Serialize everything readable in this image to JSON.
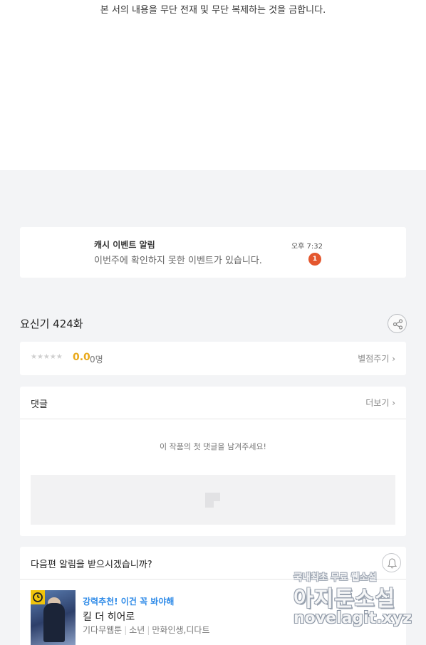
{
  "notice": {
    "copyright": "본 서의 내용을 무단 전재 및 무단 복제하는 것을 금합니다."
  },
  "notification": {
    "title": "캐시 이벤트 알림",
    "message": "이번주에 확인하지 못한 이벤트가 있습니다.",
    "time": "오후 7:32",
    "badge_count": "1"
  },
  "episode": {
    "title": "요신기 424화",
    "share_icon": "share-icon"
  },
  "rating": {
    "stars": "★★★★★",
    "score": "0.0",
    "count": "0명",
    "rate_link": "별점주기 ›"
  },
  "comments": {
    "label": "댓글",
    "more": "더보기 ›",
    "empty_text": "이 작품의 첫 댓글을 남겨주세요!"
  },
  "next_episode": {
    "question": "다음편 알림을 받으시겠습니까?",
    "bell_icon": "bell-icon"
  },
  "recommendation": {
    "promo": "강력추천! 이건 꼭 봐야해",
    "title": "킬 더 히어로",
    "author": "기다무웹툰",
    "genre": "소년",
    "tags": "만화인생,디다트"
  },
  "watermark": {
    "line1": "국내최초 무료 웹소설",
    "line2": "아지툰소설",
    "line3": "novelagit.xyz"
  },
  "colors": {
    "accent_score": "#e9a91b",
    "promo_blue": "#2f8be8",
    "badge_red": "#e4572e",
    "page_bg": "#f3f4f6"
  }
}
